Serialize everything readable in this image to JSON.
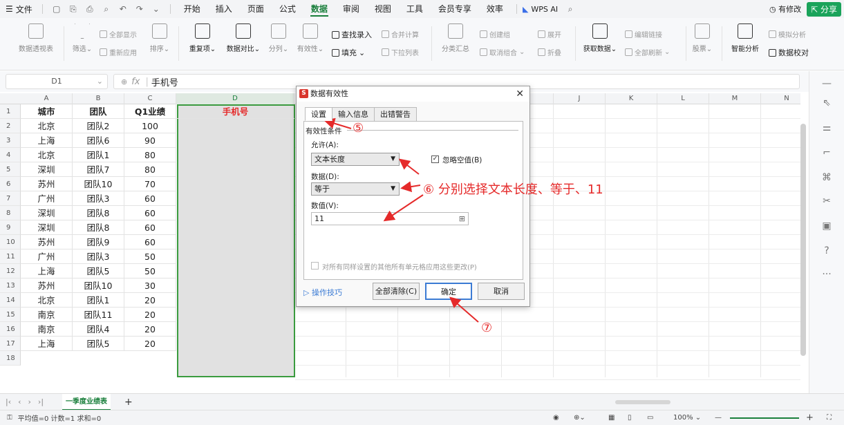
{
  "menubar": {
    "file_label": "文件",
    "tabs": [
      "开始",
      "插入",
      "页面",
      "公式",
      "数据",
      "审阅",
      "视图",
      "工具",
      "会员专享",
      "效率"
    ],
    "active_tab": "数据",
    "wps_ai": "WPS AI",
    "modified": "有修改",
    "share": "分享"
  },
  "ribbon": {
    "pivot": "数据透视表",
    "filter": "筛选",
    "show_all": "全部显示",
    "reapply": "重新应用",
    "sort": "排序",
    "duplicates": "重复项",
    "compare": "数据对比",
    "split": "分列",
    "validity": "有效性",
    "find_input": "查找录入",
    "fill": "填充",
    "consolidate": "合并计算",
    "dropdown": "下拉列表",
    "subtotal": "分类汇总",
    "group": "创建组",
    "ungroup": "取消组合",
    "expand": "展开",
    "fold": "折叠",
    "get_data": "获取数据",
    "edit_links": "编辑链接",
    "refresh_all": "全部刷新",
    "stock": "股票",
    "smart_analysis": "智能分析",
    "simulate": "模拟分析",
    "check_data": "数据校对"
  },
  "formula": {
    "cell_ref": "D1",
    "content": "手机号",
    "fx": "fx"
  },
  "columns": [
    "A",
    "B",
    "C",
    "D",
    "E",
    "F",
    "G",
    "H",
    "I",
    "J",
    "K",
    "L",
    "M",
    "N"
  ],
  "rows": [
    "1",
    "2",
    "3",
    "4",
    "5",
    "6",
    "7",
    "8",
    "9",
    "10",
    "11",
    "12",
    "13",
    "14",
    "15",
    "16",
    "17",
    "18"
  ],
  "table": {
    "headers": [
      "城市",
      "团队",
      "Q1业绩",
      "手机号"
    ],
    "data": [
      [
        "北京",
        "团队2",
        "100"
      ],
      [
        "上海",
        "团队6",
        "90"
      ],
      [
        "北京",
        "团队1",
        "80"
      ],
      [
        "深圳",
        "团队7",
        "80"
      ],
      [
        "苏州",
        "团队10",
        "70"
      ],
      [
        "广州",
        "团队3",
        "60"
      ],
      [
        "深圳",
        "团队8",
        "60"
      ],
      [
        "深圳",
        "团队8",
        "60"
      ],
      [
        "苏州",
        "团队9",
        "60"
      ],
      [
        "广州",
        "团队3",
        "50"
      ],
      [
        "上海",
        "团队5",
        "50"
      ],
      [
        "苏州",
        "团队10",
        "30"
      ],
      [
        "北京",
        "团队1",
        "20"
      ],
      [
        "南京",
        "团队11",
        "20"
      ],
      [
        "南京",
        "团队4",
        "20"
      ],
      [
        "上海",
        "团队5",
        "20"
      ]
    ]
  },
  "dialog": {
    "title": "数据有效性",
    "tabs": [
      "设置",
      "输入信息",
      "出错警告"
    ],
    "section": "有效性条件",
    "allow_label": "允许(A):",
    "allow_value": "文本长度",
    "ignore_blank": "忽略空值(B)",
    "data_label": "数据(D):",
    "data_value": "等于",
    "value_label": "数值(V):",
    "value": "11",
    "apply_all": "对所有同样设置的其他所有单元格应用这些更改(P)",
    "tips": "操作技巧",
    "clear_all": "全部清除(C)",
    "ok": "确定",
    "cancel": "取消"
  },
  "annotations": {
    "step5": "⑤",
    "step6": "⑥ 分别选择文本长度、等于、11",
    "step7": "⑦"
  },
  "sheet": {
    "tab": "一季度业绩表",
    "add": "+"
  },
  "status": {
    "summary": "平均值=0  计数=1  求和=0",
    "zoom": "100%"
  },
  "colors": {
    "accent": "#1a7f3c",
    "annotation": "#e52a2a",
    "selection": "#3a9b3e"
  }
}
